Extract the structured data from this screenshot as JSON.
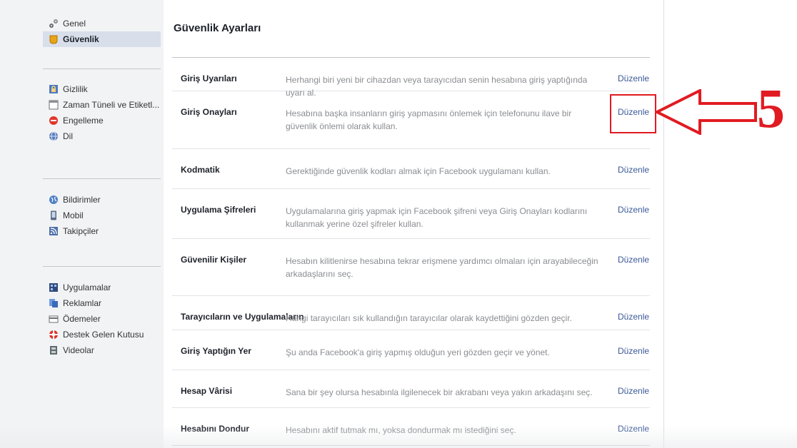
{
  "colors": {
    "sidebar_bg": "#f2f3f5",
    "active_item_bg": "#d8dfea",
    "link_blue": "#3b5998",
    "desc_gray": "#8a8d91",
    "annotation_red": "#e11b22"
  },
  "sidebar": {
    "groups": [
      {
        "items": [
          {
            "label": "Genel",
            "icon": "gears-icon",
            "active": false
          },
          {
            "label": "Güvenlik",
            "icon": "shield-badge-icon",
            "active": true
          }
        ]
      },
      {
        "items": [
          {
            "label": "Gizlilik",
            "icon": "lock-icon",
            "active": false
          },
          {
            "label": "Zaman Tüneli ve Etiketl...",
            "icon": "timeline-icon",
            "active": false
          },
          {
            "label": "Engelleme",
            "icon": "block-icon",
            "active": false
          },
          {
            "label": "Dil",
            "icon": "globe-icon",
            "active": false
          }
        ]
      },
      {
        "items": [
          {
            "label": "Bildirimler",
            "icon": "notification-globe-icon",
            "active": false
          },
          {
            "label": "Mobil",
            "icon": "mobile-icon",
            "active": false
          },
          {
            "label": "Takipçiler",
            "icon": "rss-icon",
            "active": false
          }
        ]
      },
      {
        "items": [
          {
            "label": "Uygulamalar",
            "icon": "apps-icon",
            "active": false
          },
          {
            "label": "Reklamlar",
            "icon": "ads-icon",
            "active": false
          },
          {
            "label": "Ödemeler",
            "icon": "card-icon",
            "active": false
          },
          {
            "label": "Destek Gelen Kutusu",
            "icon": "lifebuoy-icon",
            "active": false
          },
          {
            "label": "Videolar",
            "icon": "film-icon",
            "active": false
          }
        ]
      }
    ]
  },
  "main": {
    "title": "Güvenlik Ayarları",
    "edit_label": "Düzenle",
    "rows": [
      {
        "name": "Giriş Uyarıları",
        "desc": "Herhangi biri yeni bir cihazdan veya tarayıcıdan senin hesabına giriş yaptığında uyarı al."
      },
      {
        "name": "Giriş Onayları",
        "desc": "Hesabına başka insanların giriş yapmasını önlemek için telefonunu ilave bir güvenlik önlemi olarak kullan."
      },
      {
        "name": "Kodmatik",
        "desc": "Gerektiğinde güvenlik kodları almak için Facebook uygulamanı kullan."
      },
      {
        "name": "Uygulama Şifreleri",
        "desc": "Uygulamalarına giriş yapmak için Facebook şifreni veya Giriş Onayları kodlarını kullanmak yerine özel şifreler kullan."
      },
      {
        "name": "Güvenilir Kişiler",
        "desc": "Hesabın kilitlenirse hesabına tekrar erişmene yardımcı olmaları için arayabileceğin arkadaşlarını seç."
      },
      {
        "name": "Tarayıcıların ve Uygulamaların",
        "desc": "Hangi tarayıcıları sık kullandığın tarayıcılar olarak kaydettiğini gözden geçir."
      },
      {
        "name": "Giriş Yaptığın Yer",
        "desc": "Şu anda Facebook'a giriş yapmış olduğun yeri gözden geçir ve yönet."
      },
      {
        "name": "Hesap Vârisi",
        "desc": "Sana bir şey olursa hesabınla ilgilenecek bir akrabanı veya yakın arkadaşını seç."
      },
      {
        "name": "Hesabını Dondur",
        "desc": "Hesabını aktif tutmak mı, yoksa dondurmak mı istediğini seç."
      }
    ]
  },
  "annotation": {
    "number": "5"
  }
}
